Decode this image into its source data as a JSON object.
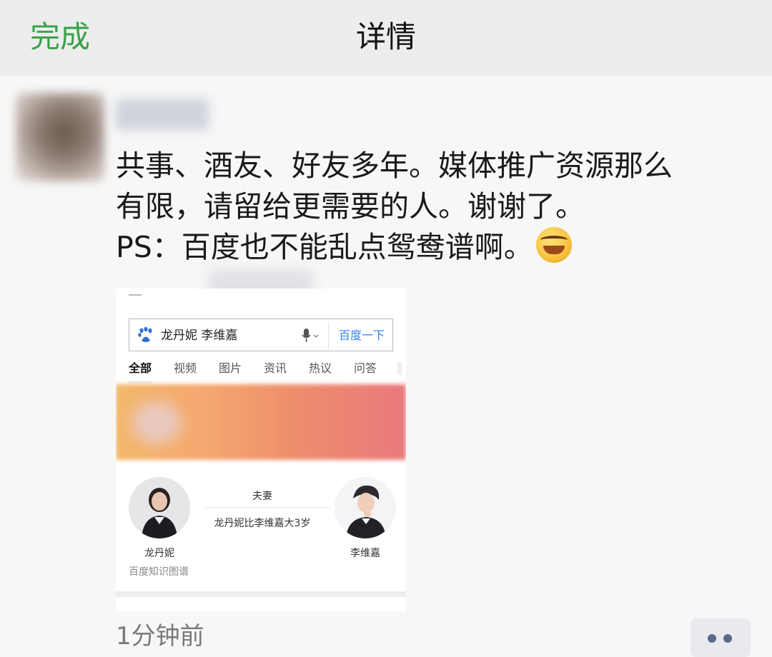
{
  "navbar": {
    "done_label": "完成",
    "title": "详情"
  },
  "post": {
    "lines": [
      "共事、酒友、好友多年。媒体推广资源那么",
      "有限，请留给更需要的人。谢谢了。",
      "PS：百度也不能乱点鸳鸯谱啊。"
    ],
    "emoji": "laughing-tears-emoji",
    "timestamp": "1分钟前"
  },
  "screenshot": {
    "search_query": "龙丹妮 李维嘉",
    "search_button": "百度一下",
    "tabs": [
      "全部",
      "视频",
      "图片",
      "资讯",
      "热议",
      "问答"
    ],
    "knowledge_graph": {
      "relation": "夫妻",
      "detail": "龙丹妮比李维嘉大3岁",
      "person_left": "龙丹妮",
      "person_right": "李维嘉",
      "source": "百度知识图谱"
    }
  },
  "colors": {
    "done": "#3aa24a",
    "search_link": "#3385ff",
    "more_dots": "#5b6a8c"
  }
}
